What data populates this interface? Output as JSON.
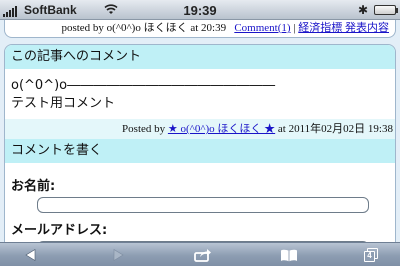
{
  "status_bar": {
    "carrier": "SoftBank",
    "time": "19:39"
  },
  "entry_footer": {
    "posted_prefix": "posted by o(^0^)o ほくほく at 20:39",
    "comment_link": "Comment(1)",
    "separator": " | ",
    "category_link": "経済指標 発表内容"
  },
  "comments_section": {
    "heading": "この記事へのコメント",
    "comment": {
      "line1": "o(^0^)o――――――――――――――――",
      "line2": "テスト用コメント",
      "posted_by_label": "Posted by ",
      "author_link": "★ o(^0^)o ほくほく ★",
      "posted_at": " at 2011年02月02日 19:38"
    }
  },
  "comment_form": {
    "heading": "コメントを書く",
    "name_label": "お名前:",
    "email_label": "メールアドレス:"
  },
  "toolbar": {
    "back_icon": "back-arrow-icon",
    "forward_icon": "forward-arrow-icon",
    "share_icon": "share-icon",
    "bookmarks_icon": "bookmarks-icon",
    "pages_count": "4"
  }
}
